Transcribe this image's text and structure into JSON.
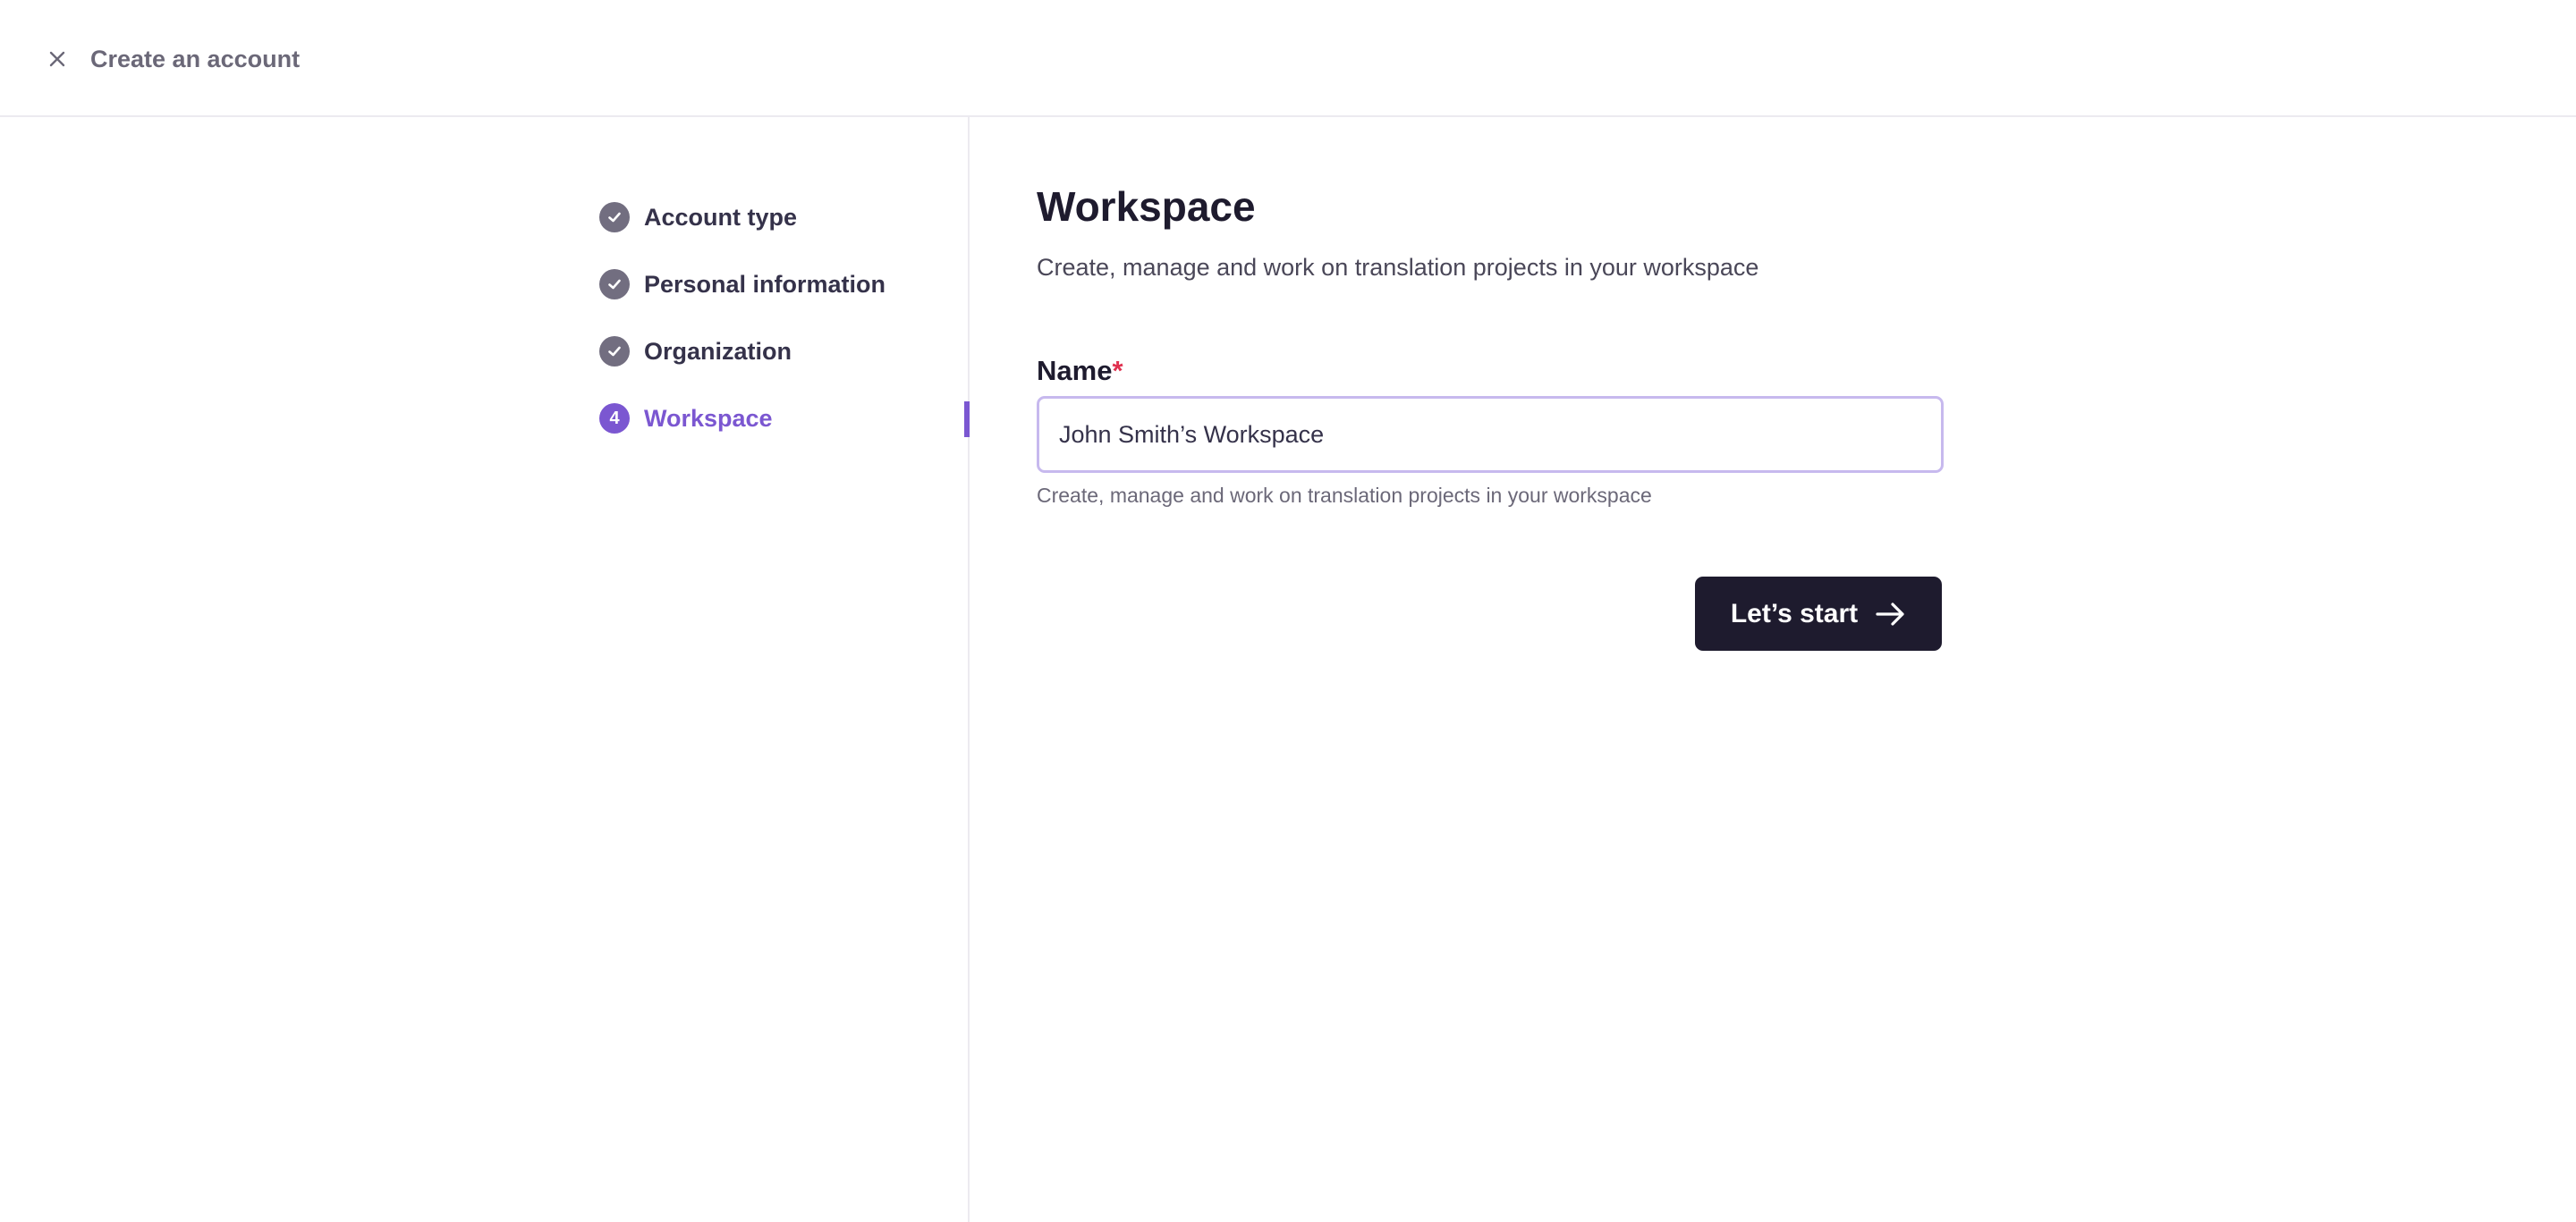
{
  "header": {
    "title": "Create an account",
    "close_icon": "close-icon"
  },
  "stepper": {
    "steps": [
      {
        "label": "Account type",
        "status": "complete",
        "icon": "check-icon"
      },
      {
        "label": "Personal information",
        "status": "complete",
        "icon": "check-icon"
      },
      {
        "label": "Organization",
        "status": "complete",
        "icon": "check-icon"
      },
      {
        "label": "Workspace",
        "status": "active",
        "number": "4"
      }
    ]
  },
  "main": {
    "title": "Workspace",
    "subtitle": "Create, manage and work on translation projects in your workspace",
    "name_field": {
      "label": "Name",
      "required_mark": "*",
      "value": "John Smith’s Workspace",
      "helper": "Create, manage and work on translation projects in your workspace"
    },
    "submit_label": "Let’s start",
    "submit_icon": "arrow-right-icon"
  },
  "colors": {
    "accent": "#7b57d1",
    "dark": "#1e1b2e",
    "complete_step": "#726e80",
    "required": "#e0314f"
  }
}
